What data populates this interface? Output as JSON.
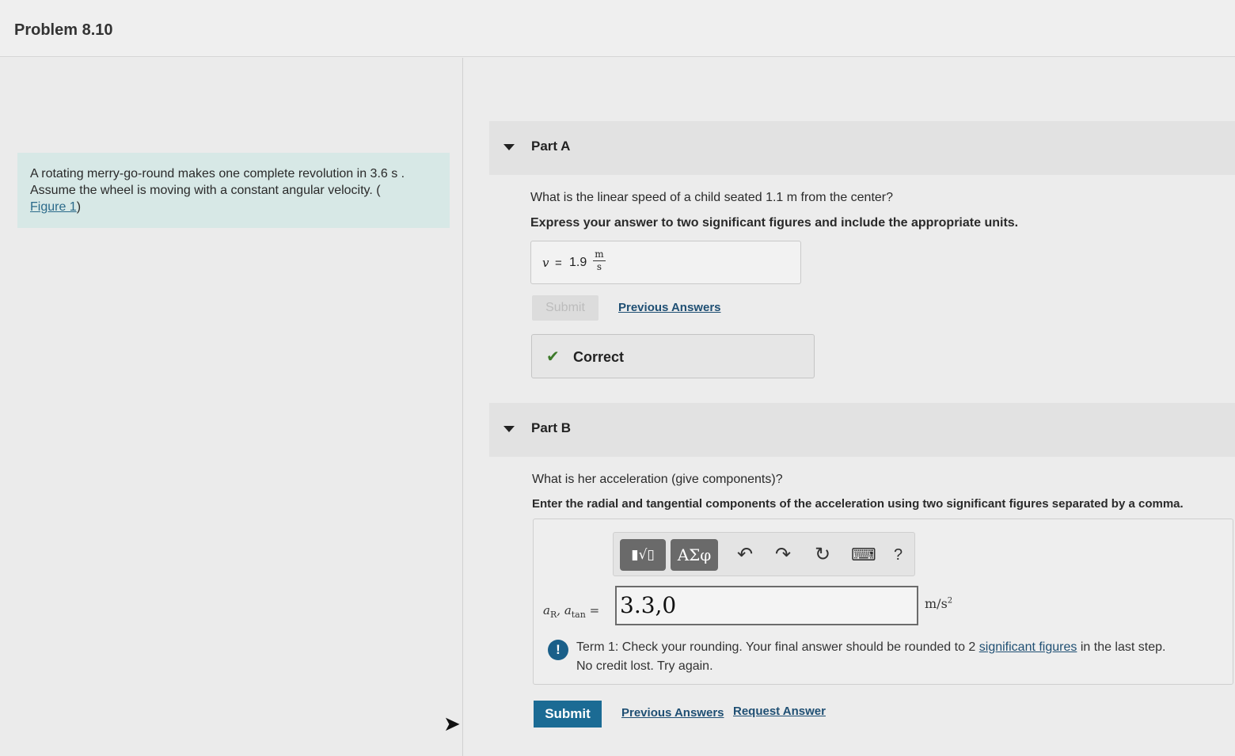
{
  "header": {
    "title": "Problem 8.10"
  },
  "problem": {
    "text_1": "A rotating merry-go-round makes one complete revolution in 3.6 s .",
    "text_2": "Assume the wheel is moving with a constant angular velocity. (",
    "figure_link": "Figure 1",
    "text_3": ")"
  },
  "part_a": {
    "label": "Part A",
    "question": "What is the linear speed of a child seated 1.1 m from the center?",
    "instruction": "Express your answer to two significant figures and include the appropriate units.",
    "answer": {
      "variable": "v",
      "equals": "=",
      "value": "1.9",
      "unit_num": "m",
      "unit_den": "s"
    },
    "submit_label": "Submit",
    "previous_answers": "Previous Answers",
    "result": "Correct"
  },
  "part_b": {
    "label": "Part B",
    "question": "What is her acceleration (give components)?",
    "instruction": "Enter the radial and tangential components of the acceleration using two significant figures separated by a comma.",
    "toolbar": {
      "templates": "▮√▯",
      "symbols": "ΑΣφ",
      "undo": "↶",
      "redo": "↷",
      "reset": "↻",
      "keyboard": "⌨",
      "help": "?"
    },
    "variable_1": "a",
    "sub_1": "R",
    "separator": ",",
    "variable_2": "a",
    "sub_2": "tan",
    "equals": "=",
    "input_value": "3.3,0",
    "unit": "m/s",
    "unit_exp": "2",
    "feedback_1": "Term 1: Check your rounding. Your final answer should be rounded to 2",
    "feedback_link": "significant figures",
    "feedback_2": "in the last step.",
    "feedback_3": "No credit lost. Try again.",
    "submit_label": "Submit",
    "previous_answers": "Previous Answers",
    "request_answer": "Request Answer"
  },
  "colors": {
    "accent": "#1b6b94",
    "problem_bg": "#d7e8e6",
    "correct": "#3d7a2a",
    "warning": "#1a5f89"
  }
}
